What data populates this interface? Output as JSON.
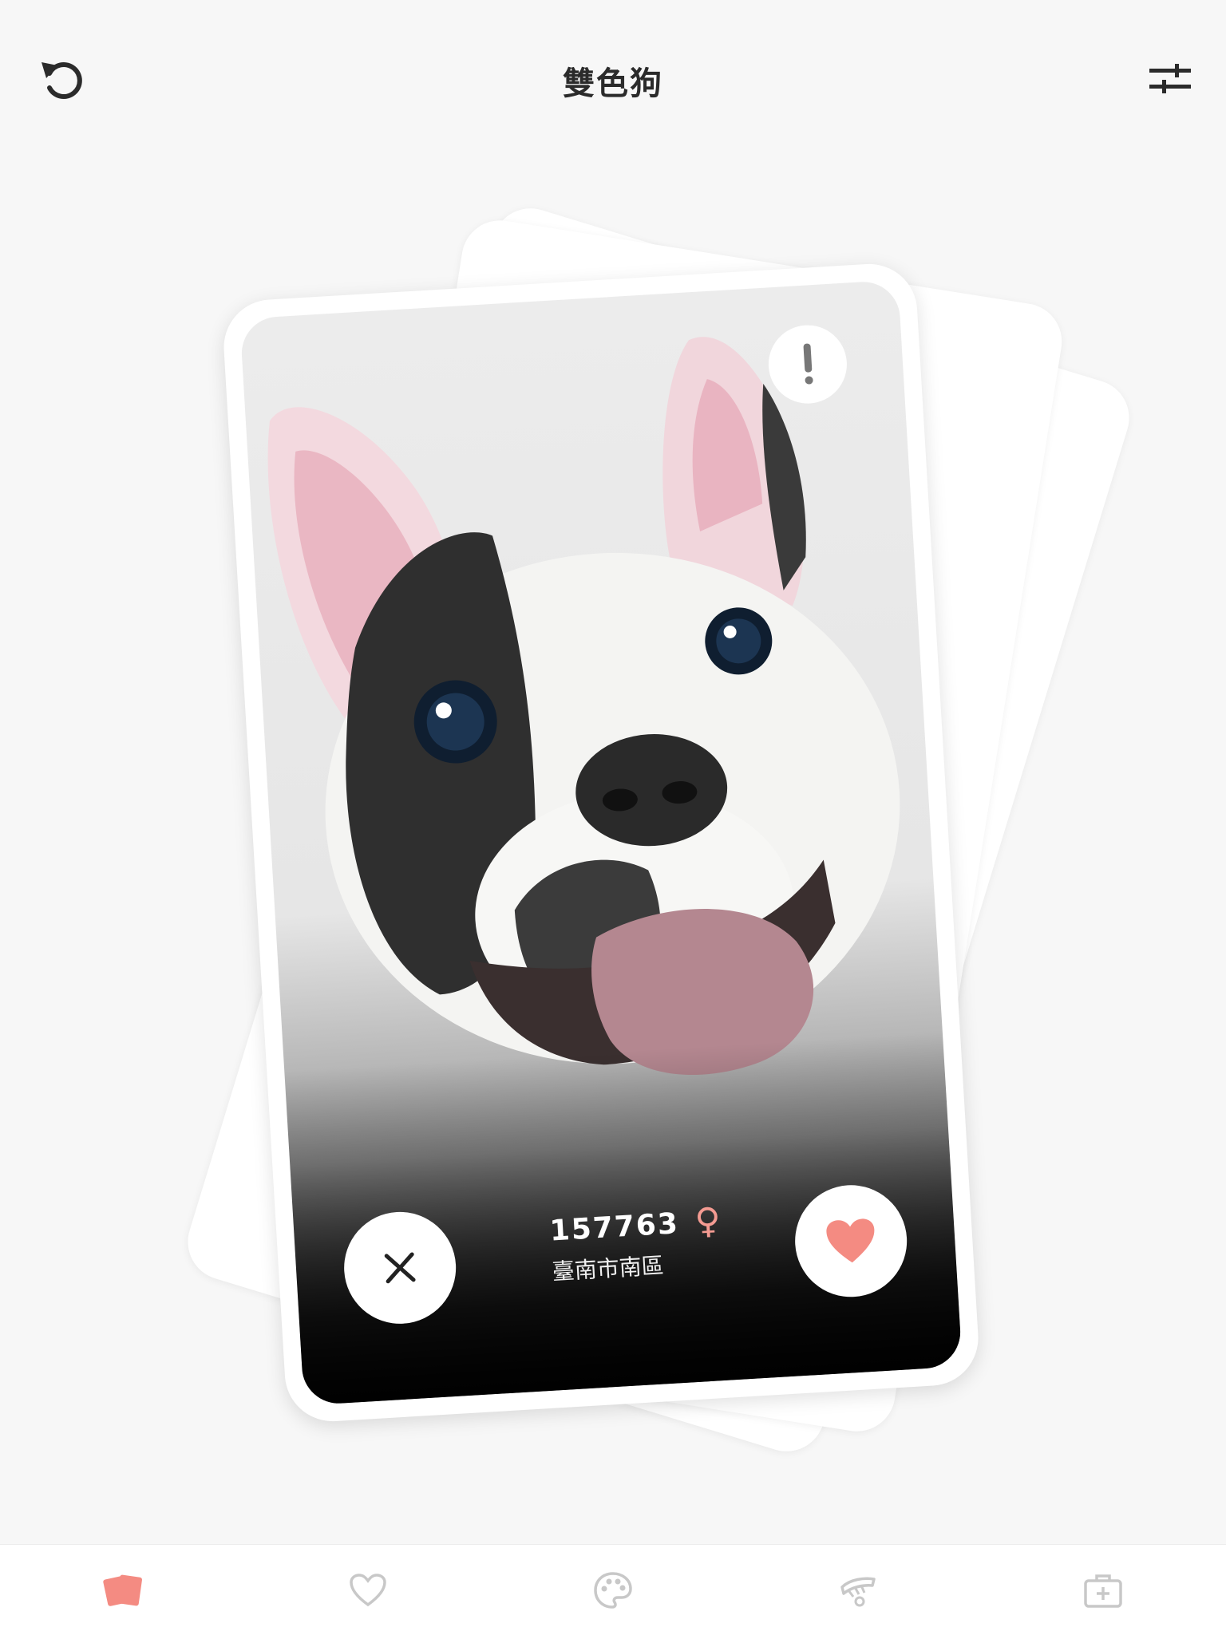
{
  "header": {
    "title": "雙色狗",
    "undo_icon": "undo-icon",
    "filter_icon": "sliders-icon"
  },
  "card": {
    "pet_id": "157763",
    "gender_symbol": "♀",
    "location": "臺南市南區",
    "report_icon": "exclamation-icon",
    "nope_icon": "close-icon",
    "like_icon": "heart-icon"
  },
  "bottom_nav": {
    "items": [
      {
        "name": "cards",
        "icon": "cards-icon",
        "active": true
      },
      {
        "name": "favorites",
        "icon": "heart-outline-icon",
        "active": false
      },
      {
        "name": "palette",
        "icon": "palette-icon",
        "active": false
      },
      {
        "name": "grooming",
        "icon": "comb-icon",
        "active": false
      },
      {
        "name": "medical",
        "icon": "medical-kit-icon",
        "active": false
      }
    ]
  },
  "colors": {
    "accent": "#f48b82",
    "inactive_icon": "#c8c8c8",
    "background": "#f7f7f7",
    "title_text": "#2b2b2b"
  }
}
